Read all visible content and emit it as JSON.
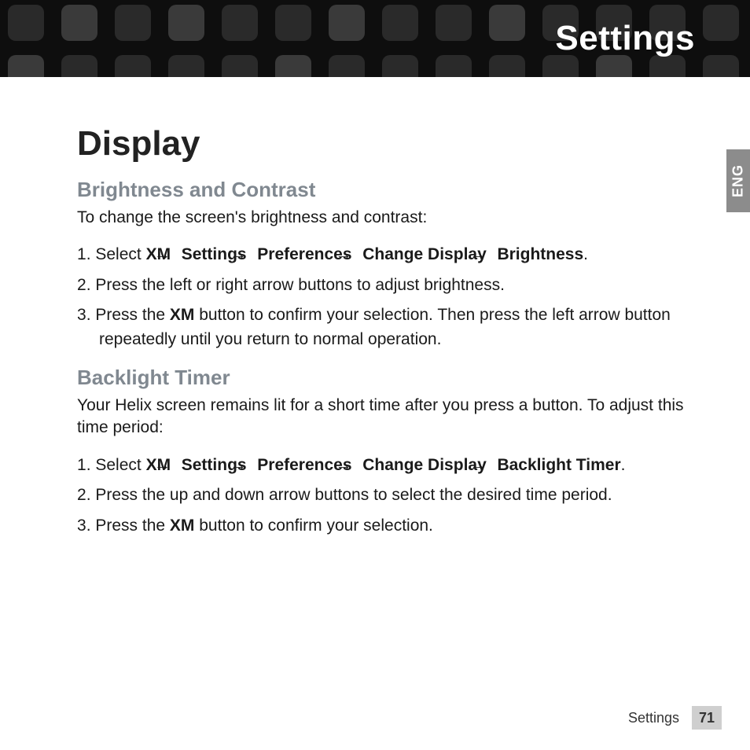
{
  "header": {
    "title": "Settings"
  },
  "langTab": "ENG",
  "page": {
    "title": "Display",
    "section1": {
      "heading": "Brightness and Contrast",
      "lead": "To change the screen's brightness and contrast:",
      "step1_prefix": "Select ",
      "nav": {
        "a": "XM",
        "b": "Settings",
        "c": "Preferences",
        "d": "Change Display",
        "e": "Brightness"
      },
      "step2": "Press the left or right arrow buttons to adjust brightness.",
      "step3_a": "Press the ",
      "step3_b": "XM",
      "step3_c": " button to confirm your selection. Then press the left arrow button repeatedly until you return to normal operation."
    },
    "section2": {
      "heading": "Backlight Timer",
      "lead": "Your Helix screen remains lit for a short time after you press a button. To adjust this time period:",
      "step1_prefix": "Select ",
      "nav": {
        "a": "XM",
        "b": "Settings",
        "c": "Preferences",
        "d": "Change Display",
        "e": "Backlight Timer"
      },
      "step2": "Press the up and down arrow buttons to select the desired time period.",
      "step3_a": "Press the ",
      "step3_b": "XM",
      "step3_c": " button to confirm your selection."
    }
  },
  "footer": {
    "section": "Settings",
    "pageNumber": "71"
  },
  "glyphs": {
    "arrow": "→"
  }
}
